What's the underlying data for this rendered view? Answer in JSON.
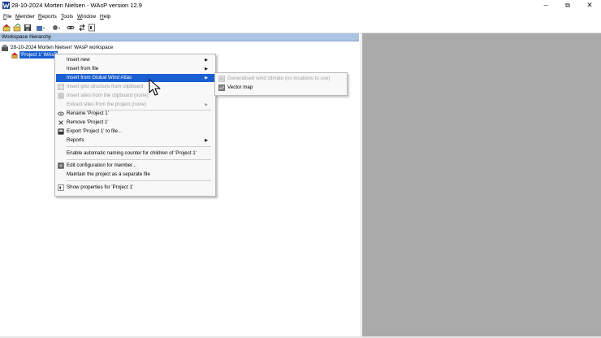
{
  "window": {
    "title": "28-10-2024 Morten Nielsen - WAsP version 12.9",
    "minimize": "–",
    "maximize": "⧉",
    "close": "✕",
    "app_icon": "wasp-app-icon"
  },
  "menubar": {
    "items": [
      {
        "key": "F",
        "rest": "ile"
      },
      {
        "key": "M",
        "rest": "ember"
      },
      {
        "key": "R",
        "rest": "eports"
      },
      {
        "key": "T",
        "rest": "ools"
      },
      {
        "key": "W",
        "rest": "indow"
      },
      {
        "key": "H",
        "rest": "elp"
      }
    ]
  },
  "panel": {
    "title": "Workspace hierarchy",
    "workspace_label": "'28-10-2024 Morten Nielsen' WAsP workspace",
    "project_label": "'Project 1' WAsP"
  },
  "context_menu": {
    "items": [
      {
        "label": "Insert new",
        "submenu": true
      },
      {
        "label": "Insert from file",
        "submenu": true
      },
      {
        "label": "Insert from Global Wind Atlas",
        "submenu": true,
        "highlighted": true
      },
      {
        "label": "Insert grid structure from clipboard",
        "disabled": true
      },
      {
        "label": "Insert sites from the clipboard (none)",
        "disabled": true
      },
      {
        "label": "Extract sites from the project (none)",
        "disabled": true,
        "submenu": true
      },
      {
        "label": "Rename 'Project 1'"
      },
      {
        "label": "Remove 'Project 1'"
      },
      {
        "label": "Export 'Project 1' to file..."
      },
      {
        "label": "Reports",
        "submenu": true
      },
      {
        "label": "Enable automatic naming counter for children of 'Project 1'"
      },
      {
        "label": "Edit configuration for member..."
      },
      {
        "label": "Maintain the project as a separate file"
      },
      {
        "label": "Show properties for 'Project 1'"
      }
    ]
  },
  "submenu": {
    "items": [
      {
        "label": "Generalised wind climate (no locations to use)",
        "disabled": true
      },
      {
        "label": "Vector map"
      }
    ]
  },
  "colors": {
    "highlight": "#1a5fd2",
    "panel_header": "#aac4e2",
    "workspace_bg": "#aaaaaa"
  }
}
